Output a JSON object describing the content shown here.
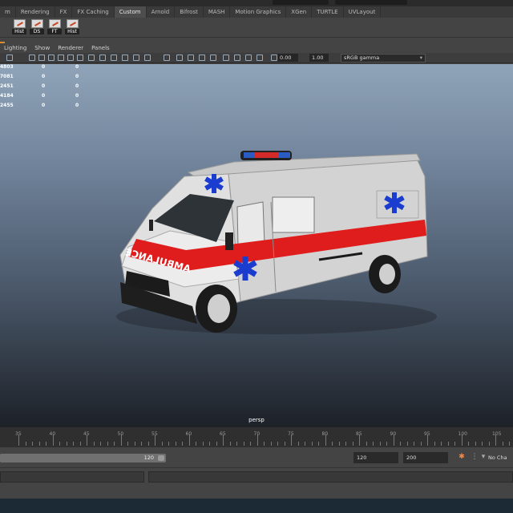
{
  "shelf": {
    "tabs": [
      "m",
      "Rendering",
      "FX",
      "FX Caching",
      "Custom",
      "Arnold",
      "Bifrost",
      "MASH",
      "Motion Graphics",
      "XGen",
      "TURTLE",
      "UVLayout"
    ],
    "active_tab": "Custom",
    "buttons": [
      {
        "label": "Hist",
        "icon": "history-icon"
      },
      {
        "label": "DS",
        "icon": "delete-history-icon"
      },
      {
        "label": "FT",
        "icon": "freeze-transform-icon"
      },
      {
        "label": "Hist",
        "icon": "history-icon"
      }
    ]
  },
  "panel_menu": [
    "Lighting",
    "Show",
    "Renderer",
    "Panels"
  ],
  "viewport_toolbar": {
    "exposure": "0.00",
    "gamma": "1.00",
    "color_space": "sRGB gamma"
  },
  "heads_up": {
    "rows": [
      [
        "4803",
        "0",
        "0"
      ],
      [
        "7081",
        "0",
        "0"
      ],
      [
        "2451",
        "0",
        "0"
      ],
      [
        "4184",
        "0",
        "0"
      ],
      [
        "2455",
        "0",
        "0"
      ]
    ]
  },
  "vehicle": {
    "decal_text": "AMBULANCE",
    "body_color": "#d8d8d8",
    "stripe_color": "#e01d1d",
    "star_color": "#1a3ccf"
  },
  "viewport": {
    "camera": "persp"
  },
  "timeline": {
    "labels": [
      "35",
      "40",
      "45",
      "50",
      "55",
      "60",
      "65",
      "70",
      "75",
      "80",
      "85",
      "90",
      "95",
      "100",
      "105"
    ]
  },
  "range": {
    "slider_value": "120",
    "start": "120",
    "end": "200",
    "character_set": "No Cha"
  }
}
